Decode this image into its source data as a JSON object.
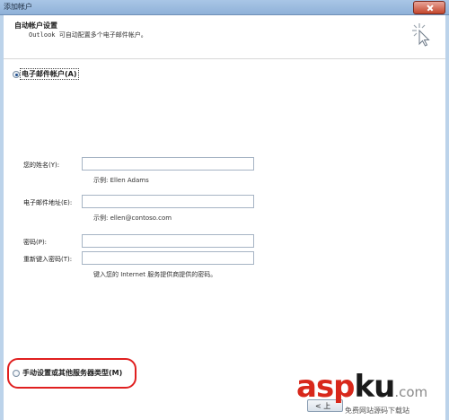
{
  "window": {
    "title": "添加帐户"
  },
  "header": {
    "title": "自动帐户设置",
    "subtitle": "Outlook 可自动配置多个电子邮件帐户。",
    "icon": "wizard-cursor-icon"
  },
  "options": {
    "email_account_label": "电子邮件帐户(A)",
    "email_account_selected": true,
    "manual_setup_label": "手动设置或其他服务器类型(M)",
    "manual_setup_selected": false
  },
  "form": {
    "name_label": "您的姓名(Y):",
    "name_value": "",
    "name_example": "示例: Ellen Adams",
    "email_label": "电子邮件地址(E):",
    "email_value": "",
    "email_example": "示例: ellen@contoso.com",
    "password_label": "密码(P):",
    "password_value": "",
    "retype_password_label": "重新键入密码(T):",
    "retype_password_value": "",
    "password_hint": "键入您的 Internet 服务提供商提供的密码。"
  },
  "buttons": {
    "next_fragment": "< 上"
  },
  "watermark": {
    "logo_asp": "asp",
    "logo_ku": "ku",
    "logo_tld": ".com",
    "caption": "免费网站源码下载站"
  },
  "colors": {
    "highlight": "#e02020",
    "titlebar": "#a9c6e6",
    "logo_red": "#d8281b"
  }
}
